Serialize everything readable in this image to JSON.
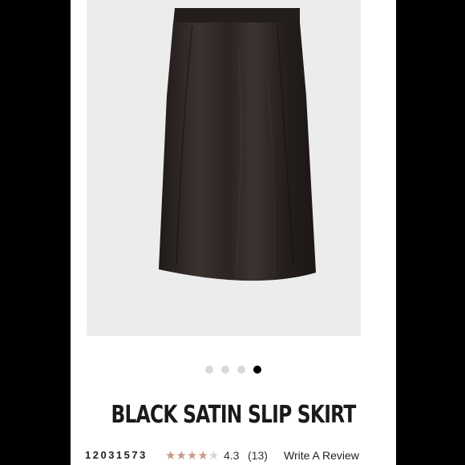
{
  "product": {
    "title": "BLACK SATIN SLIP SKIRT",
    "sku": "12031573",
    "rating": "4.3",
    "review_count": "(13)",
    "rating_value": 4.3,
    "rating_max": 5,
    "write_review_label": "Write A Review"
  },
  "carousel": {
    "total": 4,
    "active_index": 3
  },
  "image": {
    "icon": "skirt-image",
    "background_color": "#ececec",
    "skirt_color": "#2a2421"
  },
  "colors": {
    "star_filled": "#c89a86",
    "star_empty": "#d6d6d6",
    "dot_active": "#000000",
    "dot_inactive": "#d9d9d9"
  }
}
